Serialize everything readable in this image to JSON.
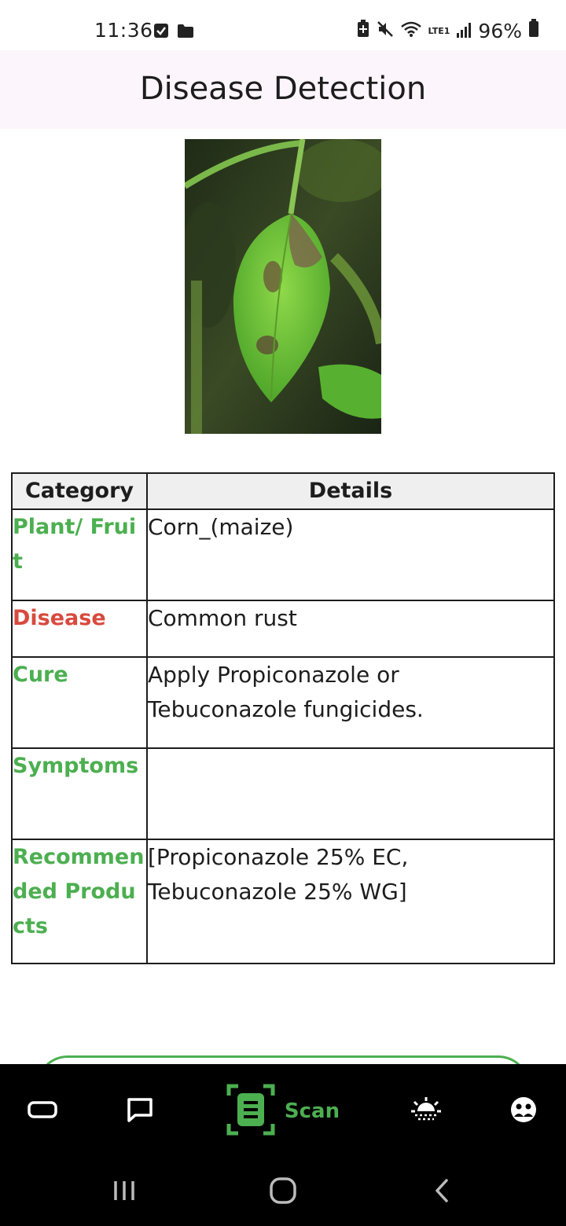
{
  "status_bar": {
    "time": "11:36",
    "battery": "96%",
    "network_label": "LTE1",
    "icons": [
      "check-box-icon",
      "folder-icon",
      "battery-saver-icon",
      "mute-icon",
      "wifi-icon",
      "signal-icon",
      "battery-icon"
    ]
  },
  "app_bar": {
    "title": "Disease Detection"
  },
  "image": {
    "description_icon": "leaf-photo"
  },
  "table": {
    "headers": {
      "category": "Category",
      "details": "Details"
    },
    "rows": [
      {
        "category": "Plant/ Fruit",
        "details": "Corn_(maize)",
        "color": "#4caf50"
      },
      {
        "category": "Disease",
        "details": "Common rust",
        "color": "#d84a3e"
      },
      {
        "category": "Cure",
        "details": "Apply Propiconazole or Tebuconazole fungicides.",
        "color": "#4caf50"
      },
      {
        "category": "Symptoms",
        "details": "",
        "color": "#4caf50"
      },
      {
        "category": "Recommended Products",
        "details": "[Propiconazole 25% EC, Tebuconazole 25% WG]",
        "color": "#4caf50"
      }
    ]
  },
  "bottom_nav": {
    "items": [
      {
        "icon": "card-icon"
      },
      {
        "icon": "chat-icon"
      },
      {
        "icon": "scan-icon",
        "label": "Scan",
        "active": true
      },
      {
        "icon": "weather-icon"
      },
      {
        "icon": "community-icon"
      }
    ]
  },
  "system_nav": {
    "icons": [
      "recents-icon",
      "home-icon",
      "back-icon"
    ]
  },
  "colors": {
    "accent": "#4caf50",
    "danger": "#d84a3e",
    "app_bar_bg": "#fcf5fb",
    "nav_bg": "#000000"
  }
}
